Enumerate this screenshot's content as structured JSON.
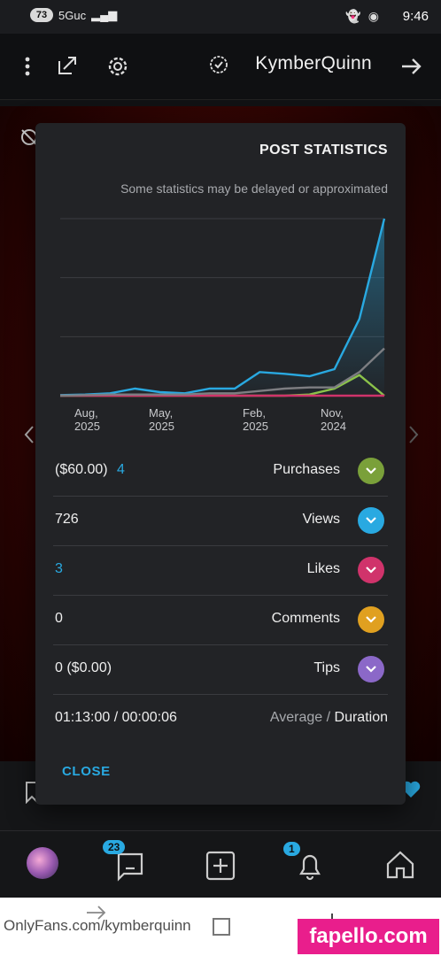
{
  "status_bar": {
    "time": "9:46",
    "network": "5Guc",
    "battery": "73"
  },
  "header": {
    "title": "KymberQuinn"
  },
  "dialog": {
    "title": "POST STATISTICS",
    "subtitle": "Some statistics may be delayed or approximated",
    "close_label": "CLOSE",
    "rows": [
      {
        "label": "Purchases",
        "value_main": "4",
        "value_extra": "($60.00)",
        "color": "#7aa03a"
      },
      {
        "label": "Views",
        "value_main": "726",
        "color": "#29a9e1"
      },
      {
        "label": "Likes",
        "value_main": "3",
        "color": "#d0336b"
      },
      {
        "label": "Comments",
        "value_main": "0",
        "color": "#e0a020"
      },
      {
        "label": "Tips",
        "value_main": "0 ($0.00)",
        "color": "#8b68c8"
      }
    ],
    "duration": {
      "label_main": "Duration",
      "label_sep": " / ",
      "label_sub": "Average",
      "value": "01:13:00 / 00:00:06"
    }
  },
  "chart_data": {
    "type": "line",
    "x": [
      "Nov, 2024",
      "Feb, 2025",
      "May, 2025",
      "Aug, 2025"
    ],
    "ylim": [
      0,
      300
    ],
    "grid": true,
    "series": [
      {
        "name": "Views",
        "color": "#29a9e1",
        "values": [
          300,
          130,
          45,
          33,
          37,
          40,
          12,
          12,
          4,
          6,
          12,
          4,
          2,
          1
        ]
      },
      {
        "name": "Purchases",
        "color": "#8bc34a",
        "values": [
          0,
          35,
          12,
          2,
          0,
          0,
          0,
          0,
          0,
          0,
          0,
          0,
          0,
          0
        ]
      },
      {
        "name": "Likes",
        "color": "#d0336b",
        "values": [
          0,
          0,
          0,
          0,
          0,
          0,
          0,
          0,
          0,
          0,
          0,
          0,
          0,
          0
        ]
      },
      {
        "name": "Duration",
        "color": "#7d7e82",
        "values": [
          80,
          40,
          14,
          14,
          12,
          8,
          4,
          4,
          2,
          2,
          2,
          2,
          1,
          0
        ]
      }
    ]
  },
  "bottom_nav": {
    "messages_badge": "23",
    "notifications_badge": "1"
  },
  "browser": {
    "url": "OnlyFans.com/kymberquinn",
    "watermark": "fapello.com"
  }
}
